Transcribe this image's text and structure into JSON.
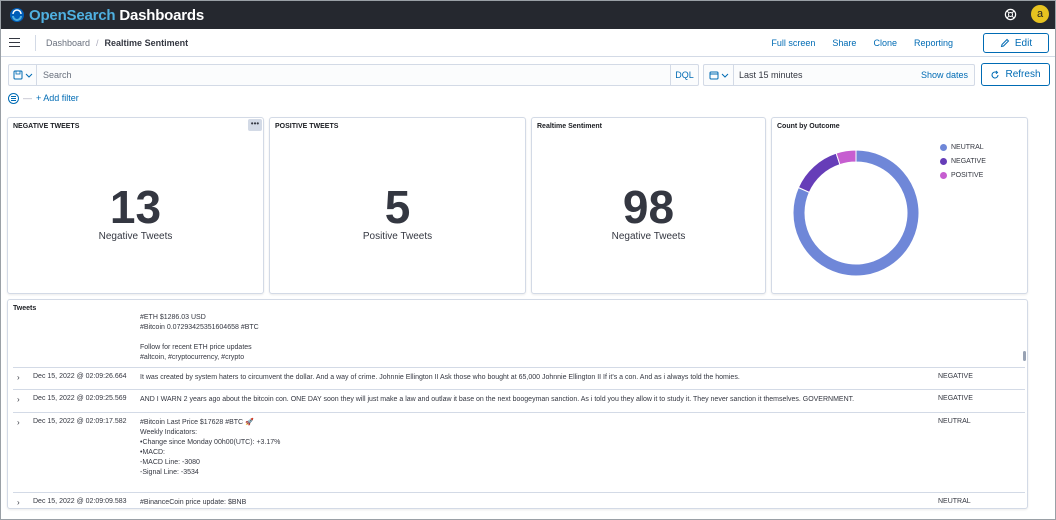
{
  "app": {
    "title_prefix": "OpenSearch",
    "title_suffix": " Dashboards",
    "avatar_letter": "a",
    "brand_color": "#25282f",
    "accent_color": "#006bb4"
  },
  "breadcrumb": {
    "parent": "Dashboard",
    "current": "Realtime Sentiment"
  },
  "header_actions": [
    "Full screen",
    "Share",
    "Clone",
    "Reporting"
  ],
  "edit_label": "Edit",
  "query": {
    "placeholder": "Search",
    "language": "DQL"
  },
  "time": {
    "range": "Last 15 minutes",
    "show_dates": "Show dates",
    "refresh": "Refresh"
  },
  "filter": {
    "add_label": "+ Add filter"
  },
  "panels": {
    "negative": {
      "title": "NEGATIVE TWEETS",
      "value": "13",
      "label": "Negative Tweets",
      "options": "•••"
    },
    "positive": {
      "title": "POSITIVE TWEETS",
      "value": "5",
      "label": "Positive Tweets"
    },
    "sentiment": {
      "title": "Realtime Sentiment",
      "value": "98",
      "label": "Negative Tweets"
    },
    "outcome": {
      "title": "Count by Outcome",
      "legend": [
        {
          "label": "NEUTRAL",
          "color": "#6f87d8"
        },
        {
          "label": "NEGATIVE",
          "color": "#663db8"
        },
        {
          "label": "POSITIVE",
          "color": "#c65ed0"
        }
      ]
    }
  },
  "chart_data": {
    "type": "pie",
    "title": "Count by Outcome",
    "donut": true,
    "categories": [
      "NEUTRAL",
      "NEGATIVE",
      "POSITIVE"
    ],
    "values": [
      80,
      13,
      5
    ],
    "colors": [
      "#6f87d8",
      "#663db8",
      "#c65ed0"
    ],
    "legend_position": "top-right"
  },
  "tweets": {
    "title": "Tweets",
    "first_message": "#ETH $1286.03 USD\n#Bitcoin 0.07293425351604658 #BTC\n\nFollow for recent ETH price updates\n#altcoin, #cryptocurrency, #crypto",
    "rows": [
      {
        "time": "Dec 15, 2022 @ 02:09:26.664",
        "message": "It was created by system haters to circumvent the dollar. And a way of crime. Johnnie Ellington II Ask those who bought at 65,000 Johnnie Ellington II If it's a con.  And as i always told the homies.",
        "outcome": "NEGATIVE"
      },
      {
        "time": "Dec 15, 2022 @ 02:09:25.569",
        "message": "AND I WARN 2 years ago about the bitcoin con. ONE DAY soon they will just make a law and outlaw it base on the next boogeyman sanction. As i told you they allow it to study it. They never sanction it themselves. GOVERNMENT.",
        "outcome": "NEGATIVE"
      },
      {
        "time": "Dec 15, 2022 @ 02:09:17.582",
        "message": "#Bitcoin Last Price $17628 #BTC 🚀\nWeekly Indicators:\n•Change since Monday 00h00(UTC): +3.17%\n•MACD:\n -MACD Line: -3080\n -Signal Line: -3534",
        "outcome": "NEUTRAL"
      },
      {
        "time": "Dec 15, 2022 @ 02:09:09.583",
        "message": "#BinanceCoin price update: $BNB",
        "outcome": "NEUTRAL"
      }
    ]
  }
}
